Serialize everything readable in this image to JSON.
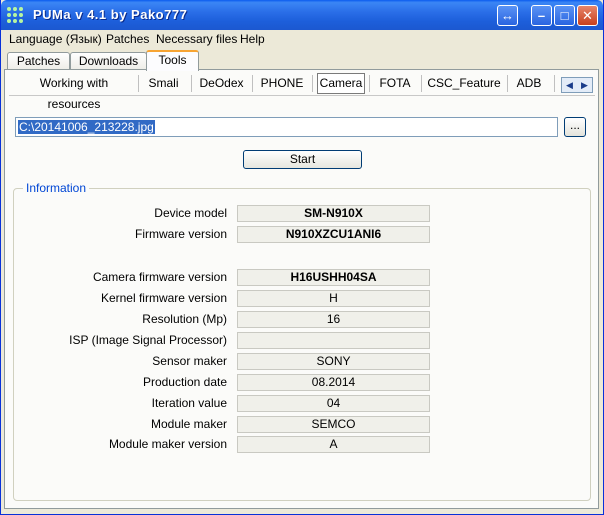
{
  "window": {
    "title": "PUMa  v 4.1  by  Pako777",
    "restore_glyph": "↔",
    "minimize_glyph": "–",
    "maximize_glyph": "□",
    "close_glyph": "✕"
  },
  "menu": [
    "Language (Язык)",
    "Patches",
    "Necessary files",
    "Help"
  ],
  "top_tabs": [
    "Patches",
    "Downloads",
    "Tools"
  ],
  "active_top_tab": "Tools",
  "sub_tabs": [
    "Working with resources",
    "Smali",
    "DeOdex",
    "PHONE",
    "Camera",
    "FOTA",
    "CSC_Feature",
    "ADB"
  ],
  "active_sub_tab": "Camera",
  "scroll_arrows": {
    "left": "◀",
    "right": "▶"
  },
  "file": {
    "path": "C:\\20141006_213228.jpg",
    "browse_label": "..."
  },
  "start_label": "Start",
  "information": {
    "legend": "Information",
    "rows": [
      {
        "label": "Device model",
        "value": "SM-N910X",
        "bold": true
      },
      {
        "label": "Firmware version",
        "value": "N910XZCU1ANI6",
        "bold": true
      },
      {
        "label": "Camera firmware version",
        "value": "H16USHH04SA",
        "bold": true
      },
      {
        "label": "Kernel firmware version",
        "value": "H",
        "bold": false
      },
      {
        "label": "Resolution (Mp)",
        "value": "16",
        "bold": false
      },
      {
        "label": "ISP (Image Signal Processor)",
        "value": "",
        "bold": false
      },
      {
        "label": "Sensor maker",
        "value": "SONY",
        "bold": false
      },
      {
        "label": "Production date",
        "value": "08.2014",
        "bold": false
      },
      {
        "label": "Iteration value",
        "value": "04",
        "bold": false
      },
      {
        "label": "Module maker",
        "value": "SEMCO",
        "bold": false
      },
      {
        "label": "Module maker version",
        "value": "A",
        "bold": false
      }
    ]
  },
  "colors": {
    "titlebar": "#1d5fdb",
    "legend": "#0046d5",
    "selection": "#316ac5",
    "active_tab_accent": "#f7a432"
  }
}
